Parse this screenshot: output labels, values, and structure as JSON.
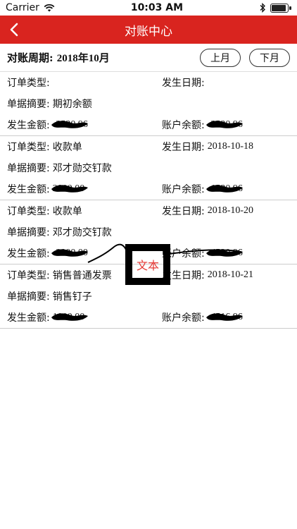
{
  "status_bar": {
    "carrier": "Carrier",
    "time": "10:03 AM"
  },
  "nav": {
    "title": "对账中心"
  },
  "period": {
    "label": "对账周期:",
    "value": "2018年10月",
    "prev_label": "上月",
    "next_label": "下月"
  },
  "labels": {
    "order_type": "订单类型:",
    "date": "发生日期:",
    "summary": "单据摘要:",
    "amount": "发生金额:",
    "balance": "账户余额:"
  },
  "records": [
    {
      "order_type": "",
      "date": "",
      "summary": "期初余额",
      "amount": "-3520.96",
      "balance": "-3520.96"
    },
    {
      "order_type": "收款单",
      "date": "2018-10-18",
      "summary": "邓才勋交钉款",
      "amount": "2000.00",
      "balance": "-1520.96"
    },
    {
      "order_type": "收款单",
      "date": "2018-10-20",
      "summary": "邓才勋交钉款",
      "amount": "-3000.00",
      "balance": "-4520.96"
    },
    {
      "order_type": "销售普通发票",
      "date": "2018-10-21",
      "summary": "销售钉子",
      "amount": "1000.00",
      "balance": "-4516.96"
    }
  ],
  "overlay": {
    "text": "文本"
  }
}
